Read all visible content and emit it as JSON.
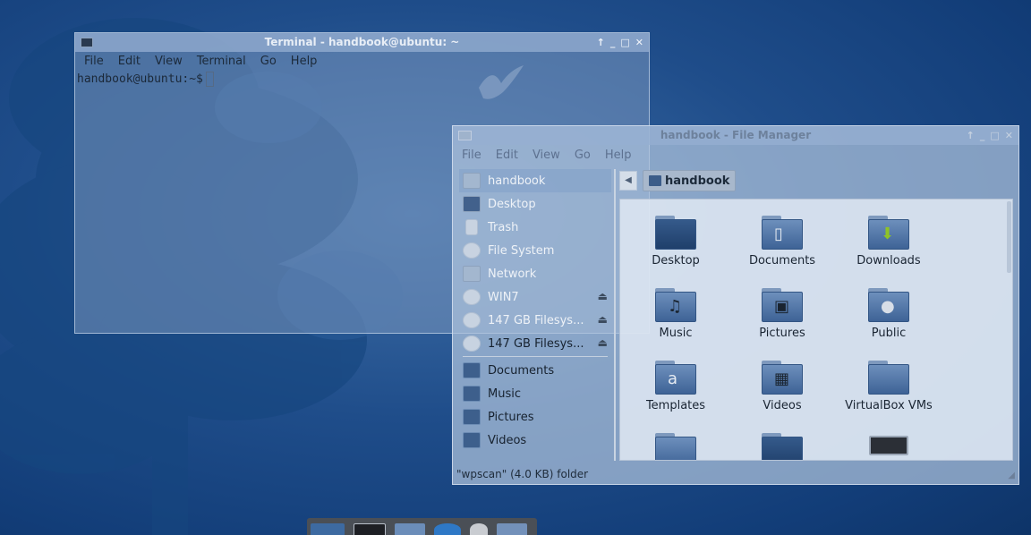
{
  "terminal": {
    "title": "Terminal - handbook@ubuntu: ~",
    "controls": [
      "↑",
      "_",
      "□",
      "✕"
    ],
    "menu": [
      "File",
      "Edit",
      "View",
      "Terminal",
      "Go",
      "Help"
    ],
    "prompt": "handbook@ubuntu:~$"
  },
  "file_manager": {
    "title": "handbook - File Manager",
    "controls": [
      "↑",
      "_",
      "□",
      "✕"
    ],
    "menu": [
      "File",
      "Edit",
      "View",
      "Go",
      "Help"
    ],
    "back_icon": "◀",
    "path": "handbook",
    "sidebar": {
      "devices": [
        {
          "label": "handbook"
        },
        {
          "label": "Desktop"
        },
        {
          "label": "Trash"
        },
        {
          "label": "File System"
        },
        {
          "label": "Network"
        },
        {
          "label": "WIN7",
          "eject": "⏏"
        },
        {
          "label": "147 GB Filesys...",
          "eject": "⏏"
        },
        {
          "label": "147 GB Filesys...",
          "eject": "⏏"
        }
      ],
      "bookmarks": [
        {
          "label": "Documents"
        },
        {
          "label": "Music"
        },
        {
          "label": "Pictures"
        },
        {
          "label": "Videos"
        }
      ]
    },
    "items": [
      {
        "name": "Desktop"
      },
      {
        "name": "Documents",
        "emblem": "▯"
      },
      {
        "name": "Downloads",
        "emblem": "⬇"
      },
      {
        "name": "Music",
        "emblem": "♫"
      },
      {
        "name": "Pictures",
        "emblem": "▣"
      },
      {
        "name": "Public",
        "emblem": "●"
      },
      {
        "name": "Templates",
        "emblem": "a"
      },
      {
        "name": "Videos",
        "emblem": "▦"
      },
      {
        "name": "VirtualBox VMs"
      }
    ],
    "status": "\"wpscan\" (4.0 KB) folder",
    "grip": "◢"
  },
  "colors": {
    "desktop_bg": "#1f4d8a",
    "dock_bg": "#4a4f56",
    "folder_blue": "#4e72a4"
  }
}
